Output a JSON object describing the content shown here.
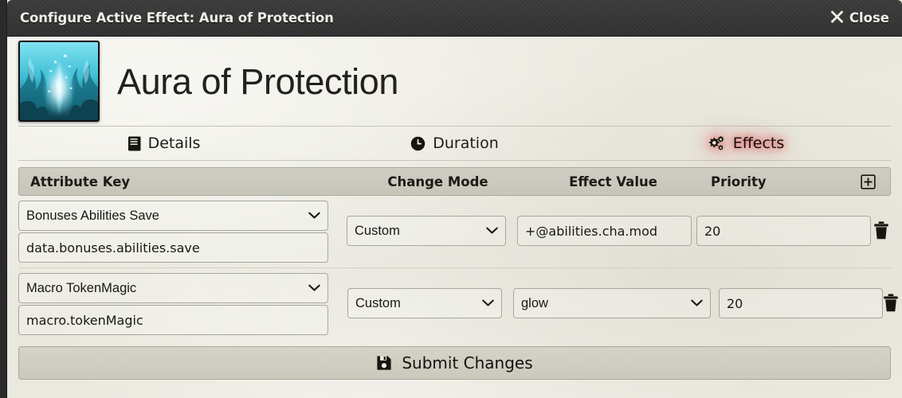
{
  "window": {
    "title": "Configure Active Effect: Aura of Protection",
    "close_label": "Close",
    "close_icon": "close-x-icon"
  },
  "effect": {
    "name": "Aura of Protection",
    "icon": "aura-flame-icon"
  },
  "tabs": [
    {
      "label": "Details",
      "icon": "book-icon",
      "active": false
    },
    {
      "label": "Duration",
      "icon": "clock-icon",
      "active": false
    },
    {
      "label": "Effects",
      "icon": "gears-icon",
      "active": true
    }
  ],
  "table": {
    "headers": {
      "key": "Attribute Key",
      "mode": "Change Mode",
      "value": "Effect Value",
      "priority": "Priority"
    },
    "add_icon": "plus-square-icon",
    "delete_icon": "trash-icon"
  },
  "rows": [
    {
      "key_select": "Bonuses Abilities Save",
      "key_input": "data.bonuses.abilities.save",
      "mode": "Custom",
      "value": "+@abilities.cha.mod",
      "value_is_select": false,
      "priority": "20"
    },
    {
      "key_select": "Macro TokenMagic",
      "key_input": "macro.tokenMagic",
      "mode": "Custom",
      "value": "glow",
      "value_is_select": true,
      "priority": "20"
    }
  ],
  "submit": {
    "label": "Submit Changes",
    "icon": "save-floppy-icon"
  },
  "colors": {
    "parchment": "#eeece3",
    "titlebar": "#333333",
    "accent_glow": "#e44646",
    "text": "#1c1b17"
  }
}
